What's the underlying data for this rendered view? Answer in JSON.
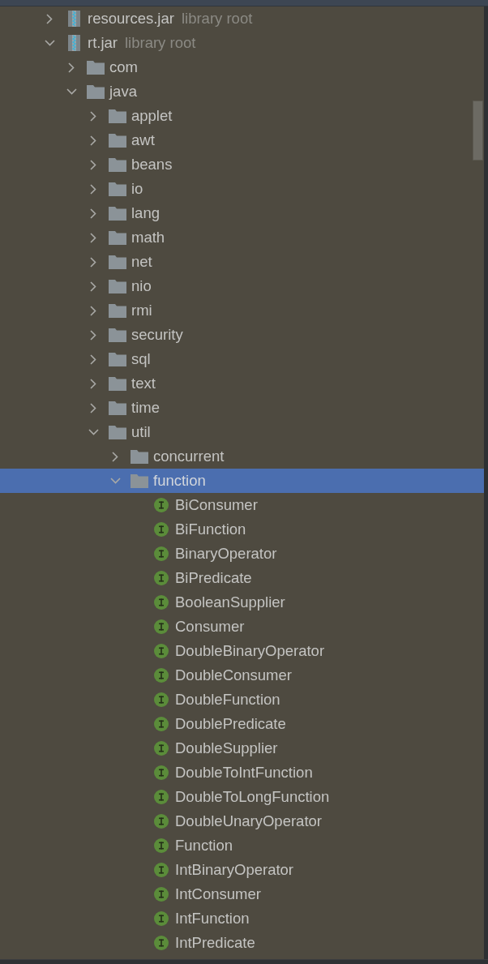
{
  "tree": [
    {
      "name": "resources.jar",
      "kind": "jar",
      "suffix": "library root",
      "expanded": false,
      "selected": false
    },
    {
      "name": "rt.jar",
      "kind": "jar",
      "suffix": "library root",
      "expanded": true,
      "selected": false,
      "children": [
        {
          "name": "com",
          "kind": "folder",
          "expanded": false,
          "selected": false
        },
        {
          "name": "java",
          "kind": "folder",
          "expanded": true,
          "selected": false,
          "children": [
            {
              "name": "applet",
              "kind": "folder",
              "expanded": false,
              "selected": false
            },
            {
              "name": "awt",
              "kind": "folder",
              "expanded": false,
              "selected": false
            },
            {
              "name": "beans",
              "kind": "folder",
              "expanded": false,
              "selected": false
            },
            {
              "name": "io",
              "kind": "folder",
              "expanded": false,
              "selected": false
            },
            {
              "name": "lang",
              "kind": "folder",
              "expanded": false,
              "selected": false
            },
            {
              "name": "math",
              "kind": "folder",
              "expanded": false,
              "selected": false
            },
            {
              "name": "net",
              "kind": "folder",
              "expanded": false,
              "selected": false
            },
            {
              "name": "nio",
              "kind": "folder",
              "expanded": false,
              "selected": false
            },
            {
              "name": "rmi",
              "kind": "folder",
              "expanded": false,
              "selected": false
            },
            {
              "name": "security",
              "kind": "folder",
              "expanded": false,
              "selected": false
            },
            {
              "name": "sql",
              "kind": "folder",
              "expanded": false,
              "selected": false
            },
            {
              "name": "text",
              "kind": "folder",
              "expanded": false,
              "selected": false
            },
            {
              "name": "time",
              "kind": "folder",
              "expanded": false,
              "selected": false
            },
            {
              "name": "util",
              "kind": "folder",
              "expanded": true,
              "selected": false,
              "children": [
                {
                  "name": "concurrent",
                  "kind": "folder",
                  "expanded": false,
                  "selected": false
                },
                {
                  "name": "function",
                  "kind": "folder",
                  "expanded": true,
                  "selected": true,
                  "children": [
                    {
                      "name": "BiConsumer",
                      "kind": "interface",
                      "selected": false
                    },
                    {
                      "name": "BiFunction",
                      "kind": "interface",
                      "selected": false
                    },
                    {
                      "name": "BinaryOperator",
                      "kind": "interface",
                      "selected": false
                    },
                    {
                      "name": "BiPredicate",
                      "kind": "interface",
                      "selected": false
                    },
                    {
                      "name": "BooleanSupplier",
                      "kind": "interface",
                      "selected": false
                    },
                    {
                      "name": "Consumer",
                      "kind": "interface",
                      "selected": false
                    },
                    {
                      "name": "DoubleBinaryOperator",
                      "kind": "interface",
                      "selected": false
                    },
                    {
                      "name": "DoubleConsumer",
                      "kind": "interface",
                      "selected": false
                    },
                    {
                      "name": "DoubleFunction",
                      "kind": "interface",
                      "selected": false
                    },
                    {
                      "name": "DoublePredicate",
                      "kind": "interface",
                      "selected": false
                    },
                    {
                      "name": "DoubleSupplier",
                      "kind": "interface",
                      "selected": false
                    },
                    {
                      "name": "DoubleToIntFunction",
                      "kind": "interface",
                      "selected": false
                    },
                    {
                      "name": "DoubleToLongFunction",
                      "kind": "interface",
                      "selected": false
                    },
                    {
                      "name": "DoubleUnaryOperator",
                      "kind": "interface",
                      "selected": false
                    },
                    {
                      "name": "Function",
                      "kind": "interface",
                      "selected": false
                    },
                    {
                      "name": "IntBinaryOperator",
                      "kind": "interface",
                      "selected": false
                    },
                    {
                      "name": "IntConsumer",
                      "kind": "interface",
                      "selected": false
                    },
                    {
                      "name": "IntFunction",
                      "kind": "interface",
                      "selected": false
                    },
                    {
                      "name": "IntPredicate",
                      "kind": "interface",
                      "selected": false
                    }
                  ]
                }
              ]
            }
          ]
        }
      ]
    }
  ]
}
